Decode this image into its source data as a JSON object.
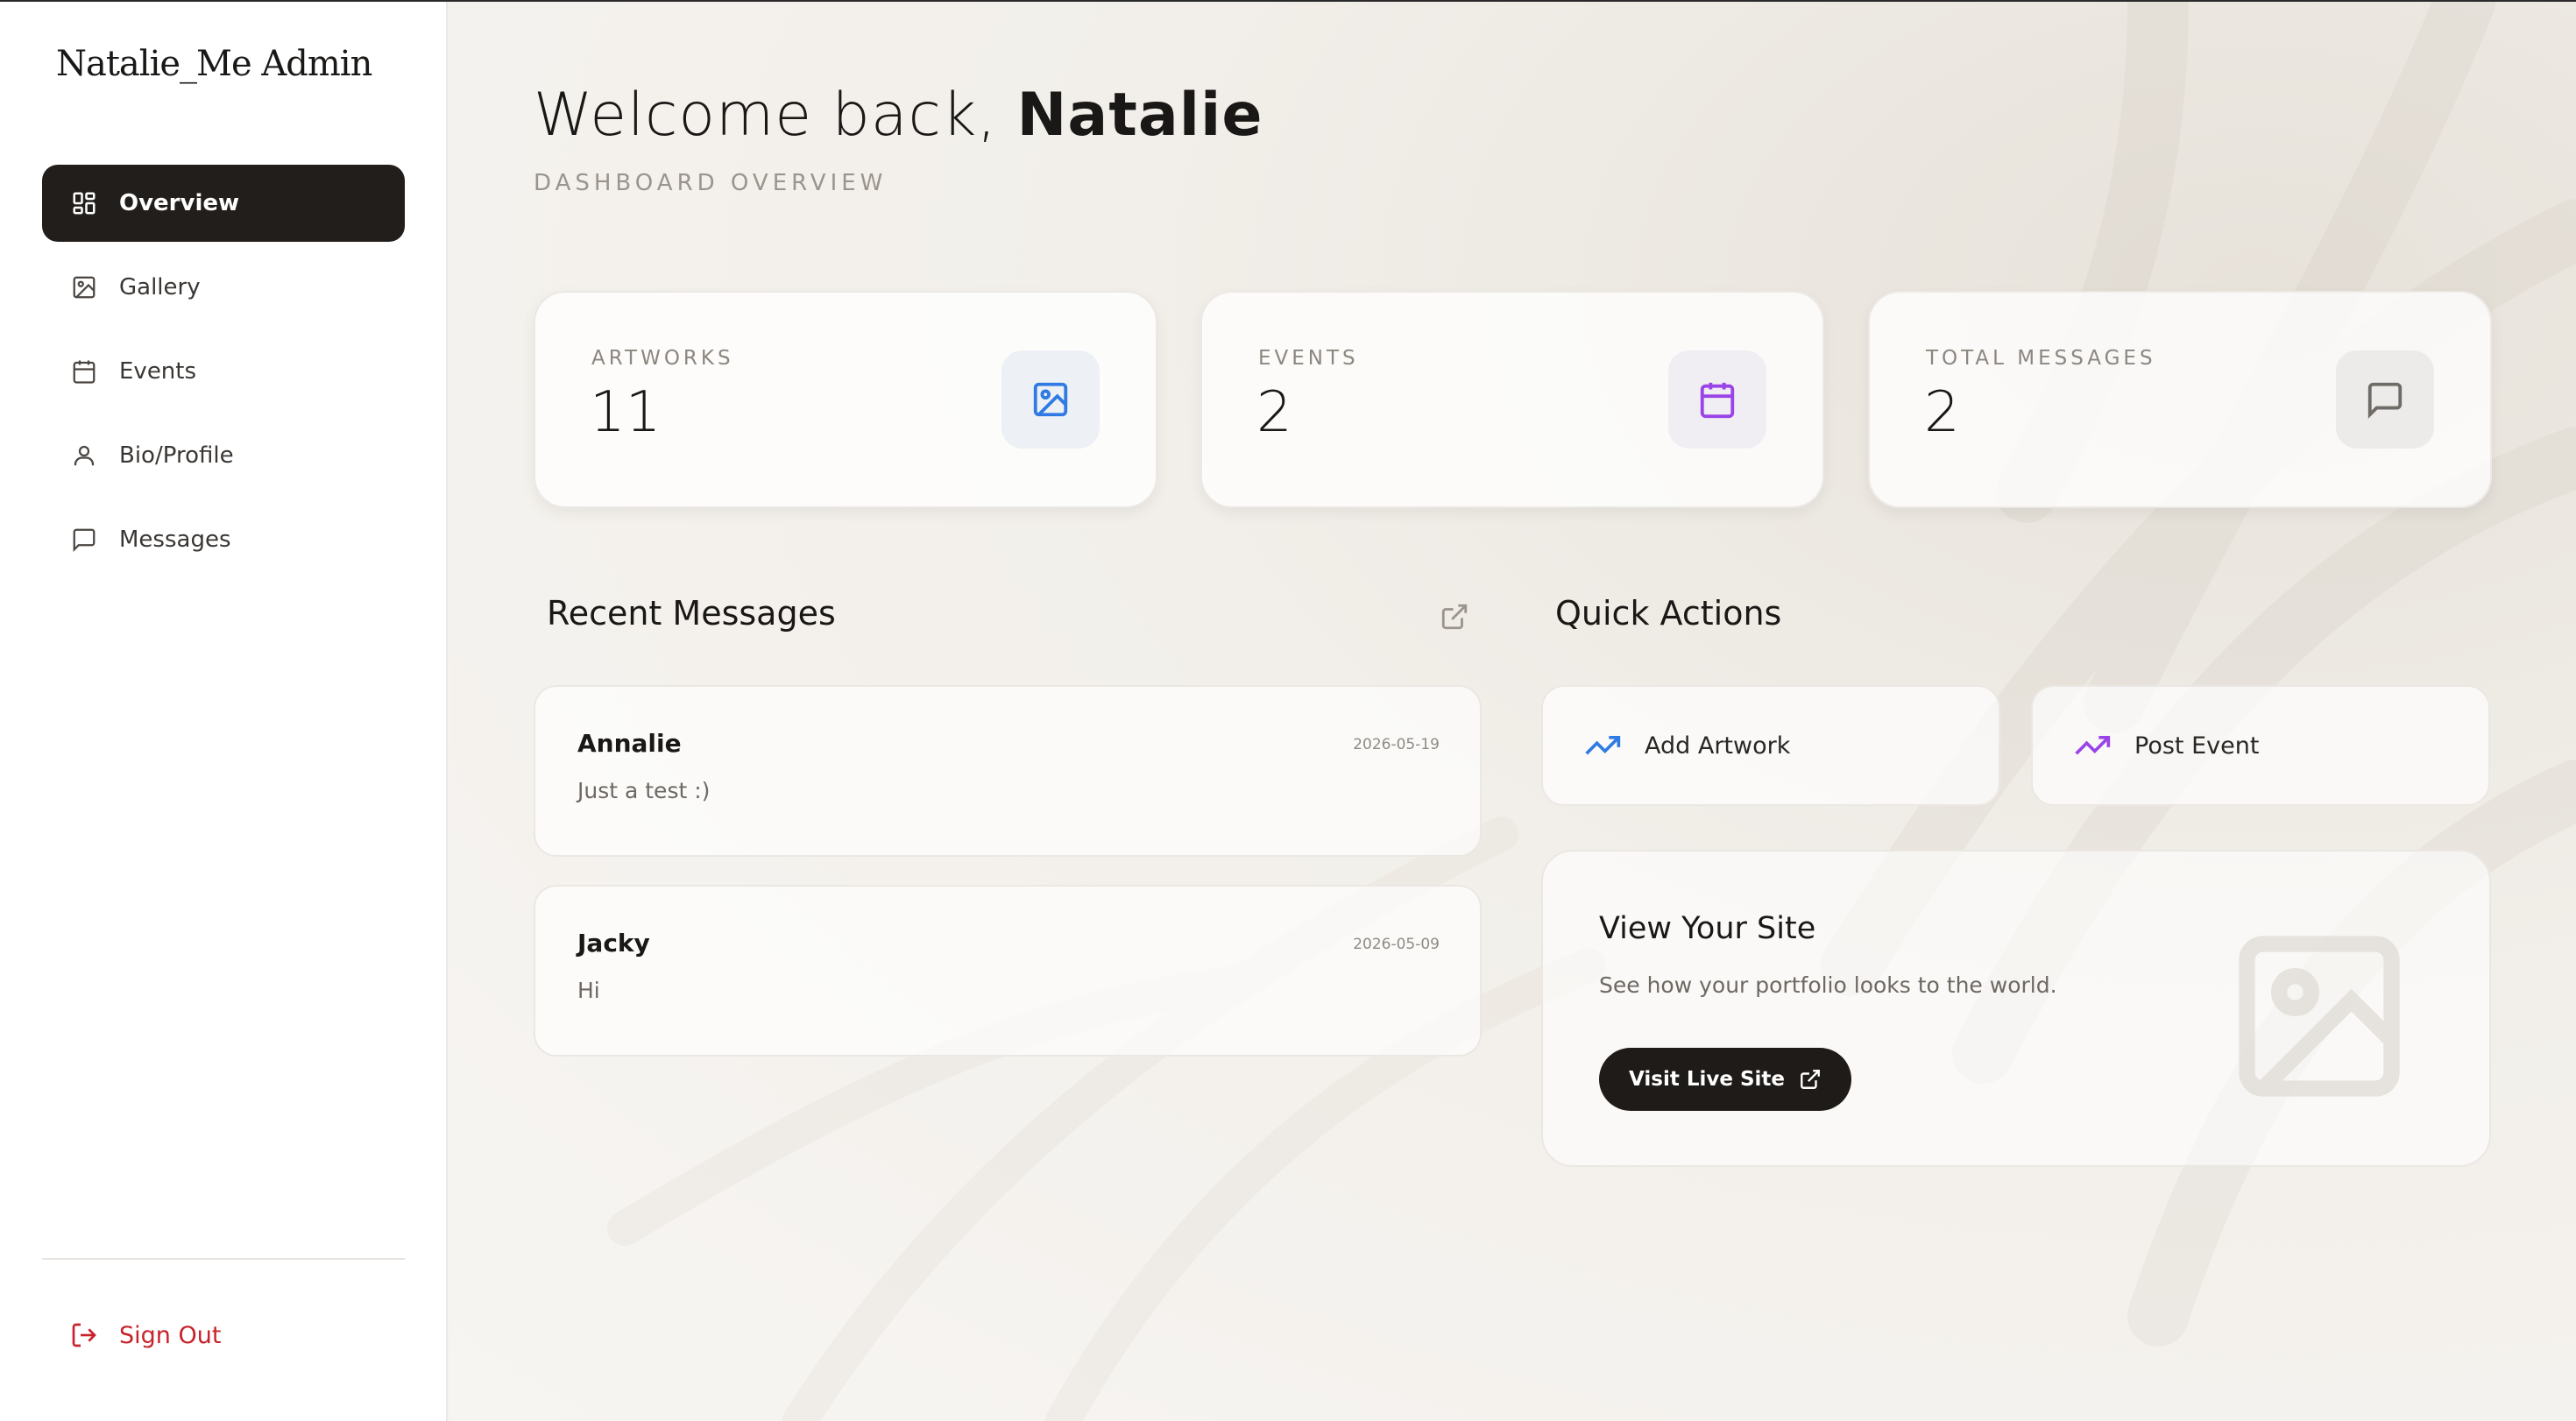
{
  "app": {
    "brand": "Natalie_Me Admin"
  },
  "sidebar": {
    "items": [
      {
        "label": "Overview",
        "icon": "grid-icon",
        "active": true
      },
      {
        "label": "Gallery",
        "icon": "image-icon"
      },
      {
        "label": "Events",
        "icon": "calendar-icon"
      },
      {
        "label": "Bio/Profile",
        "icon": "user-icon"
      },
      {
        "label": "Messages",
        "icon": "message-icon"
      }
    ],
    "sign_out": "Sign Out"
  },
  "header": {
    "welcome_prefix": "Welcome back,",
    "user_name": "Natalie",
    "subtitle": "DASHBOARD OVERVIEW"
  },
  "stats": [
    {
      "label": "ARTWORKS",
      "value": "11",
      "icon": "image-icon",
      "color": "#2f7be3"
    },
    {
      "label": "EVENTS",
      "value": "2",
      "icon": "calendar-icon",
      "color": "#9a44e8"
    },
    {
      "label": "TOTAL MESSAGES",
      "value": "2",
      "icon": "message-icon",
      "color": "#6f6b66"
    }
  ],
  "recent_messages": {
    "title": "Recent Messages",
    "items": [
      {
        "name": "Annalie",
        "date": "2026-05-19",
        "body": "Just a test :)"
      },
      {
        "name": "Jacky",
        "date": "2026-05-09",
        "body": "Hi"
      }
    ]
  },
  "quick_actions": {
    "title": "Quick Actions",
    "add_artwork": "Add Artwork",
    "post_event": "Post Event",
    "add_artwork_color": "#2f7be3",
    "post_event_color": "#9a44e8"
  },
  "view_site": {
    "title": "View Your Site",
    "description": "See how your portfolio looks to the world.",
    "button": "Visit Live Site"
  }
}
